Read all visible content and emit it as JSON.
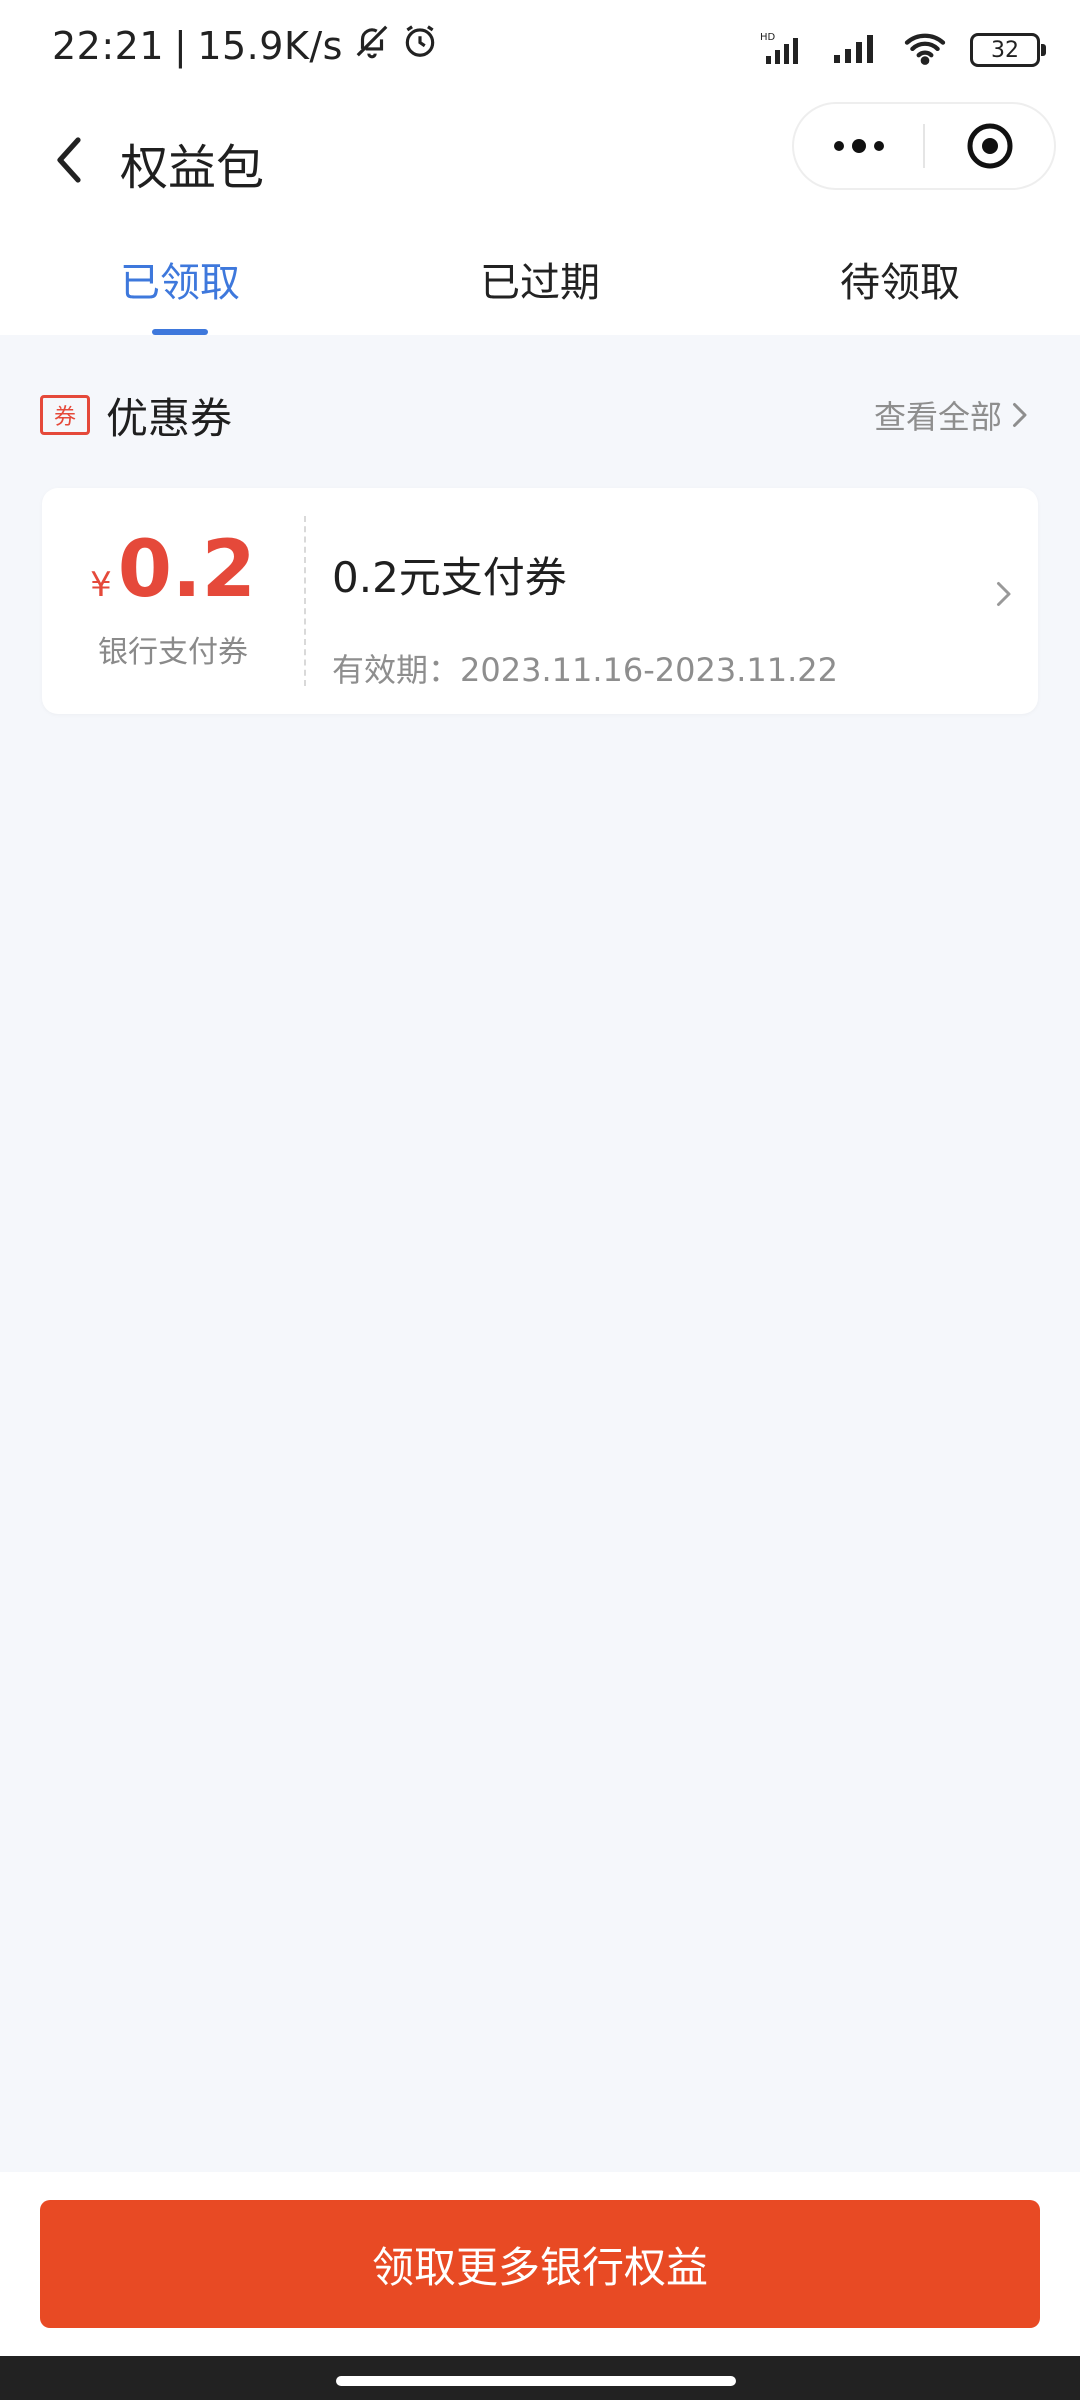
{
  "status_bar": {
    "time": "22:21",
    "separator": "|",
    "speed": "15.9K/s",
    "battery": "32"
  },
  "nav": {
    "title": "权益包"
  },
  "tabs": [
    {
      "label": "已领取"
    },
    {
      "label": "已过期"
    },
    {
      "label": "待领取"
    }
  ],
  "section": {
    "icon_text": "券",
    "title": "优惠券",
    "view_all": "查看全部"
  },
  "coupon": {
    "currency": "¥",
    "amount": "0.2",
    "type": "银行支付券",
    "name": "0.2元支付券",
    "validity": "有效期：2023.11.16-2023.11.22"
  },
  "bottom_button": {
    "label": "领取更多银行权益"
  },
  "colors": {
    "accent_blue": "#3e78dc",
    "accent_red": "#e5493a",
    "button_red": "#e84a24"
  }
}
